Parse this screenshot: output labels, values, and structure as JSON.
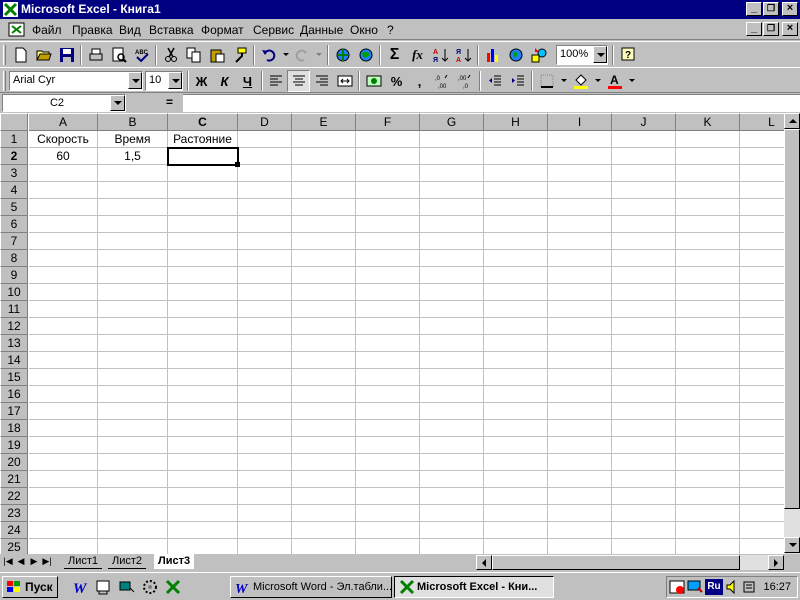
{
  "window": {
    "title": "Microsoft Excel - Книга1",
    "min_label": "_",
    "restore_label": "❐",
    "close_label": "×"
  },
  "menu": {
    "items": [
      "Файл",
      "Правка",
      "Вид",
      "Вставка",
      "Формат",
      "Сервис",
      "Данные",
      "Окно",
      "?"
    ]
  },
  "toolbar": {
    "zoom": "100%",
    "sum_label": "Σ",
    "fx_label": "fx"
  },
  "format_toolbar": {
    "font_name": "Arial Cyr",
    "font_size": "10",
    "bold_label": "Ж",
    "italic_label": "К",
    "underline_label": "Ч",
    "percent_label": "%",
    "comma_label": ","
  },
  "formula_bar": {
    "name_box": "C2",
    "equals": "=",
    "formula": ""
  },
  "grid": {
    "columns": [
      "A",
      "B",
      "C",
      "D",
      "E",
      "F",
      "G",
      "H",
      "I",
      "J",
      "K",
      "L"
    ],
    "rows": [
      "1",
      "2",
      "3",
      "4",
      "5",
      "6",
      "7",
      "8",
      "9",
      "10",
      "11",
      "12",
      "13",
      "14",
      "15",
      "16",
      "17",
      "18",
      "19",
      "20",
      "21",
      "22",
      "23",
      "24",
      "25"
    ],
    "active_cell": "C2",
    "cells": {
      "A1": "Скорость",
      "B1": "Время",
      "C1": "Растояние",
      "A2": "60",
      "B2": "1,5"
    }
  },
  "sheets": {
    "tabs": [
      "Лист1",
      "Лист2",
      "Лист3"
    ],
    "active": "Лист3"
  },
  "taskbar": {
    "start_label": "Пуск",
    "tasks": [
      {
        "label": "Microsoft Word - Эл.табли..."
      },
      {
        "label": "Microsoft Excel - Кни..."
      }
    ],
    "tray_lang": "Ru",
    "clock": "16:27"
  },
  "colors": {
    "titlebar": "#000080",
    "face": "#c0c0c0",
    "excel_green": "#008000"
  }
}
